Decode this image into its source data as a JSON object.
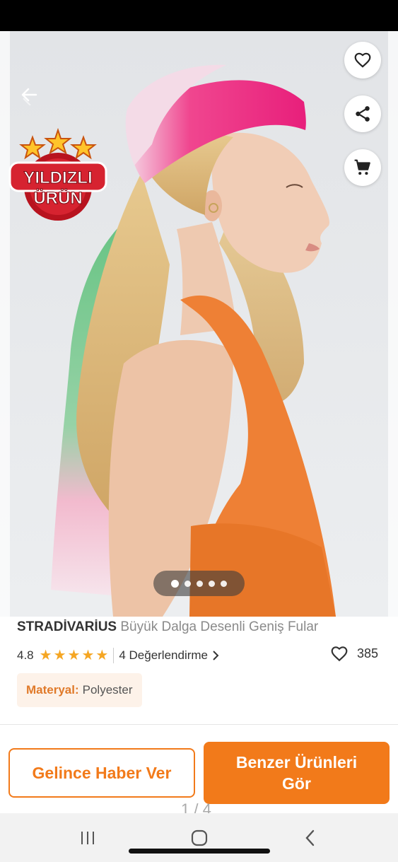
{
  "product": {
    "brand": "STRADİVARİUS",
    "name": " Büyük Dalga Desenli Geniş Fular",
    "rating": "4.8",
    "stars": 5,
    "reviews_label": "4 Değerlendirme",
    "favorites_count": "385",
    "material_key": "Materyal:",
    "material_value": "Polyester"
  },
  "badge": {
    "line1": "YILDIZLI",
    "line2": "ÜRÜN"
  },
  "gallery": {
    "total_dots": 5,
    "active_index": 0
  },
  "actions": {
    "notify_label": "Gelince Haber Ver",
    "similar_label": "Benzer Ürünleri Gör"
  },
  "ghost": {
    "counter": "1 / 4"
  },
  "icons": {
    "back": "back-arrow-icon",
    "favorite": "heart-icon",
    "share": "share-icon",
    "cart": "cart-icon"
  },
  "colors": {
    "accent": "#f27a1a",
    "star": "#f5a623",
    "material_bg": "#fdf2e9"
  }
}
